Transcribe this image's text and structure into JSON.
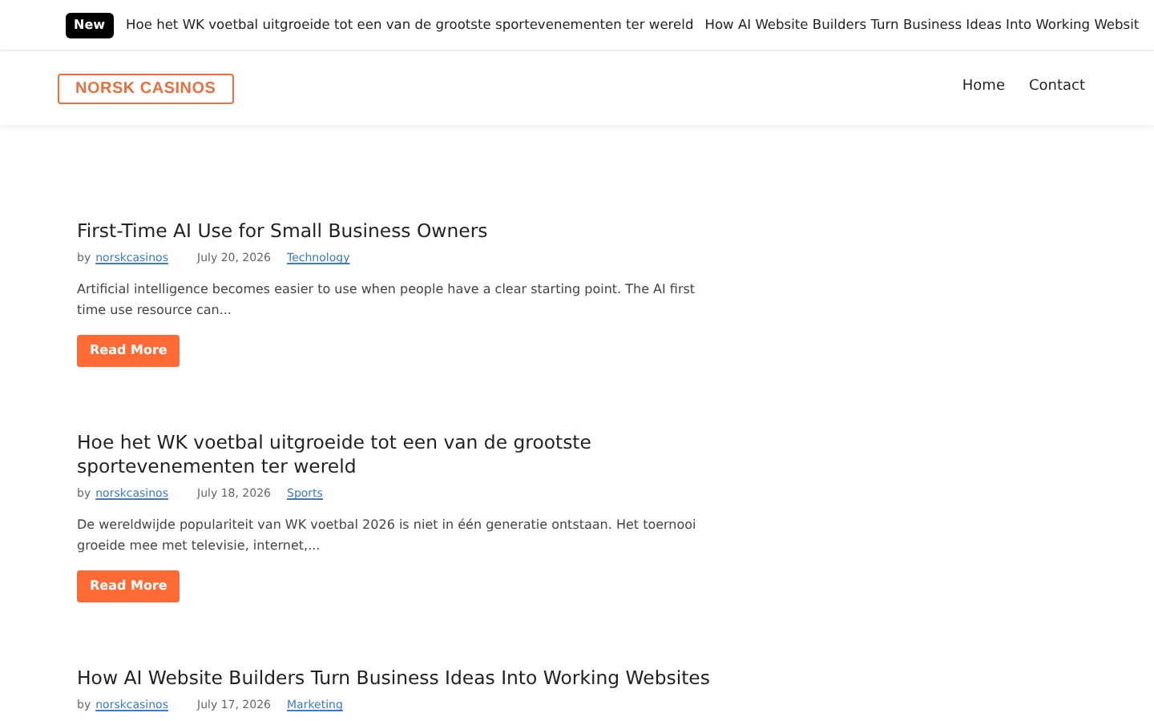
{
  "ticker": {
    "badge": "New",
    "items": [
      "Hoe het WK voetbal uitgroeide tot een van de grootste sportevenementen ter wereld",
      "How AI Website Builders Turn Business Ideas Into Working Websit"
    ]
  },
  "header": {
    "logo": "NORSK CASINOS",
    "nav": [
      "Home",
      "Contact"
    ]
  },
  "posts": [
    {
      "title": "First-Time AI Use for Small Business Owners",
      "by": "by",
      "author": "norskcasinos",
      "date": "July 20, 2026",
      "category": "Technology",
      "excerpt": "Artificial intelligence becomes easier to use when people have a clear starting point. The AI first time use resource can...",
      "button": "Read More"
    },
    {
      "title": "Hoe het WK voetbal uitgroeide tot een van de grootste sportevenementen ter wereld",
      "by": "by",
      "author": "norskcasinos",
      "date": "July 18, 2026",
      "category": "Sports",
      "excerpt": "De wereldwijde populariteit van WK voetbal 2026 is niet in één generatie ontstaan. Het toernooi groeide mee met televisie, internet,...",
      "button": "Read More"
    },
    {
      "title": "How AI Website Builders Turn Business Ideas Into Working Websites",
      "by": "by",
      "author": "norskcasinos",
      "date": "July 17, 2026",
      "category": "Marketing"
    }
  ]
}
